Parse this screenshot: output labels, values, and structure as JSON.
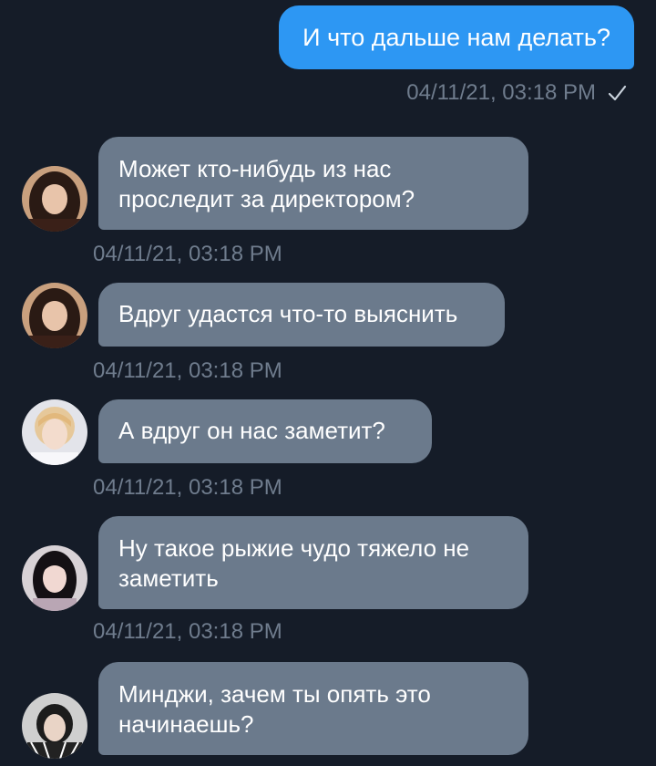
{
  "outgoing": {
    "text": "И что дальше нам делать?",
    "time": "04/11/21, 03:18 PM",
    "read_icon": "check-icon"
  },
  "incoming": [
    {
      "text": "Может кто-нибудь из нас проследит за директором?",
      "time": "04/11/21, 03:18 PM",
      "avatar_icon": "avatar-dark-hair"
    },
    {
      "text": "Вдруг удастся что-то выяснить",
      "time": "04/11/21, 03:18 PM",
      "avatar_icon": "avatar-dark-hair"
    },
    {
      "text": "А вдруг он нас заметит?",
      "time": "04/11/21, 03:18 PM",
      "avatar_icon": "avatar-light-hair"
    },
    {
      "text": "Ну такое рыжие чудо тяжело не заметить",
      "time": "04/11/21, 03:18 PM",
      "avatar_icon": "avatar-black-hair"
    },
    {
      "text": "Минджи, зачем ты опять это начинаешь?",
      "time": "",
      "avatar_icon": "avatar-dark-jacket"
    }
  ],
  "colors": {
    "background": "#151c28",
    "outgoing_bubble": "#2d97f3",
    "incoming_bubble": "#6b7a8c",
    "meta_text": "#6f7c8d"
  }
}
